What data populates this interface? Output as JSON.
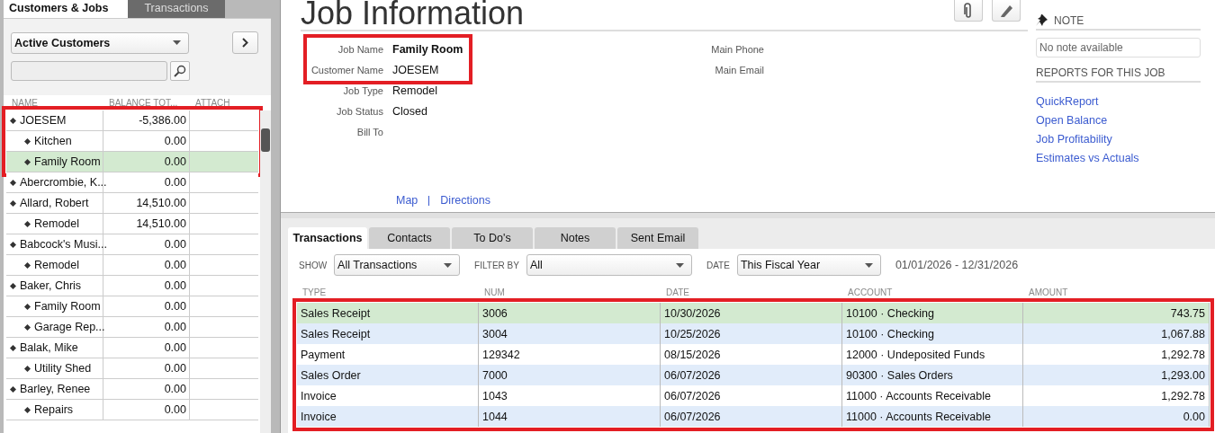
{
  "left_tabs": [
    {
      "label": "Customers & Jobs",
      "selected": true
    },
    {
      "label": "Transactions",
      "selected": false
    }
  ],
  "customer_filter": {
    "value": "Active Customers"
  },
  "customer_list": {
    "columns": [
      "NAME",
      "BALANCE TOT...",
      "ATTACH"
    ],
    "items": [
      {
        "name": "JOESEM",
        "balance": "-5,386.00",
        "selected": false,
        "children": [
          {
            "name": "Kitchen",
            "balance": "0.00",
            "selected": false
          },
          {
            "name": "Family Room",
            "balance": "0.00",
            "selected": true
          }
        ]
      },
      {
        "name": "Abercrombie, K...",
        "balance": "0.00",
        "selected": false
      },
      {
        "name": "Allard, Robert",
        "balance": "14,510.00",
        "selected": false,
        "children": [
          {
            "name": "Remodel",
            "balance": "14,510.00",
            "selected": false
          }
        ]
      },
      {
        "name": "Babcock's Musi...",
        "balance": "0.00",
        "selected": false,
        "children": [
          {
            "name": "Remodel",
            "balance": "0.00",
            "selected": false
          }
        ]
      },
      {
        "name": "Baker, Chris",
        "balance": "0.00",
        "selected": false,
        "children": [
          {
            "name": "Family Room",
            "balance": "0.00",
            "selected": false
          },
          {
            "name": "Garage Rep...",
            "balance": "0.00",
            "selected": false
          }
        ]
      },
      {
        "name": "Balak, Mike",
        "balance": "0.00",
        "selected": false,
        "children": [
          {
            "name": "Utility Shed",
            "balance": "0.00",
            "selected": false
          }
        ]
      },
      {
        "name": "Barley, Renee",
        "balance": "0.00",
        "selected": false,
        "children": [
          {
            "name": "Repairs",
            "balance": "0.00",
            "selected": false
          }
        ]
      }
    ]
  },
  "job_info": {
    "title": "Job Information",
    "fields": [
      {
        "label": "Job Name",
        "value": "Family Room",
        "kind": "bold"
      },
      {
        "label": "Customer Name",
        "value": "JOESEM",
        "kind": "plain"
      },
      {
        "label": "Job Type",
        "value": "Remodel",
        "kind": "plain"
      },
      {
        "label": "Job Status",
        "value": "Closed",
        "kind": "plain"
      },
      {
        "label": "Bill To"
      }
    ],
    "contact_labels": [
      "Main Phone",
      "Main Email"
    ],
    "links": [
      "Map",
      "Directions"
    ]
  },
  "note": {
    "title": "NOTE",
    "placeholder": "No note available"
  },
  "reports": {
    "title": "REPORTS FOR THIS JOB",
    "links": [
      "QuickReport",
      "Open Balance",
      "Job Profitability",
      "Estimates vs Actuals"
    ]
  },
  "bottom_tabs": [
    {
      "label": "Transactions",
      "selected": true
    },
    {
      "label": "Contacts",
      "selected": false
    },
    {
      "label": "To Do's",
      "selected": false
    },
    {
      "label": "Notes",
      "selected": false
    },
    {
      "label": "Sent Email",
      "selected": false
    }
  ],
  "filters": [
    {
      "label": "SHOW",
      "value": "All Transactions"
    },
    {
      "label": "FILTER BY",
      "value": "All"
    },
    {
      "label": "DATE",
      "value": "This Fiscal Year"
    }
  ],
  "date_range": "01/01/2026 - 12/31/2026",
  "transactions": {
    "columns": [
      "TYPE",
      "NUM",
      "DATE",
      "ACCOUNT",
      "AMOUNT"
    ],
    "rows": [
      {
        "cells": [
          "Sales Receipt",
          "3006",
          "10/30/2026",
          "10100 · Checking",
          "743.75"
        ],
        "selected": true
      },
      {
        "cells": [
          "Sales Receipt",
          "3004",
          "10/25/2026",
          "10100 · Checking",
          "1,067.88"
        ],
        "selected": false
      },
      {
        "cells": [
          "Payment",
          "129342",
          "08/15/2026",
          "12000 · Undeposited Funds",
          "1,292.78"
        ],
        "selected": false
      },
      {
        "cells": [
          "Sales Order",
          "7000",
          "06/07/2026",
          "90300 · Sales Orders",
          "1,293.00"
        ],
        "selected": false
      },
      {
        "cells": [
          "Invoice",
          "1043",
          "06/07/2026",
          "11000 · Accounts Receivable",
          "1,292.78"
        ],
        "selected": false
      },
      {
        "cells": [
          "Invoice",
          "1044",
          "06/07/2026",
          "11000 · Accounts Receivable",
          "0.00"
        ],
        "selected": false
      }
    ]
  }
}
